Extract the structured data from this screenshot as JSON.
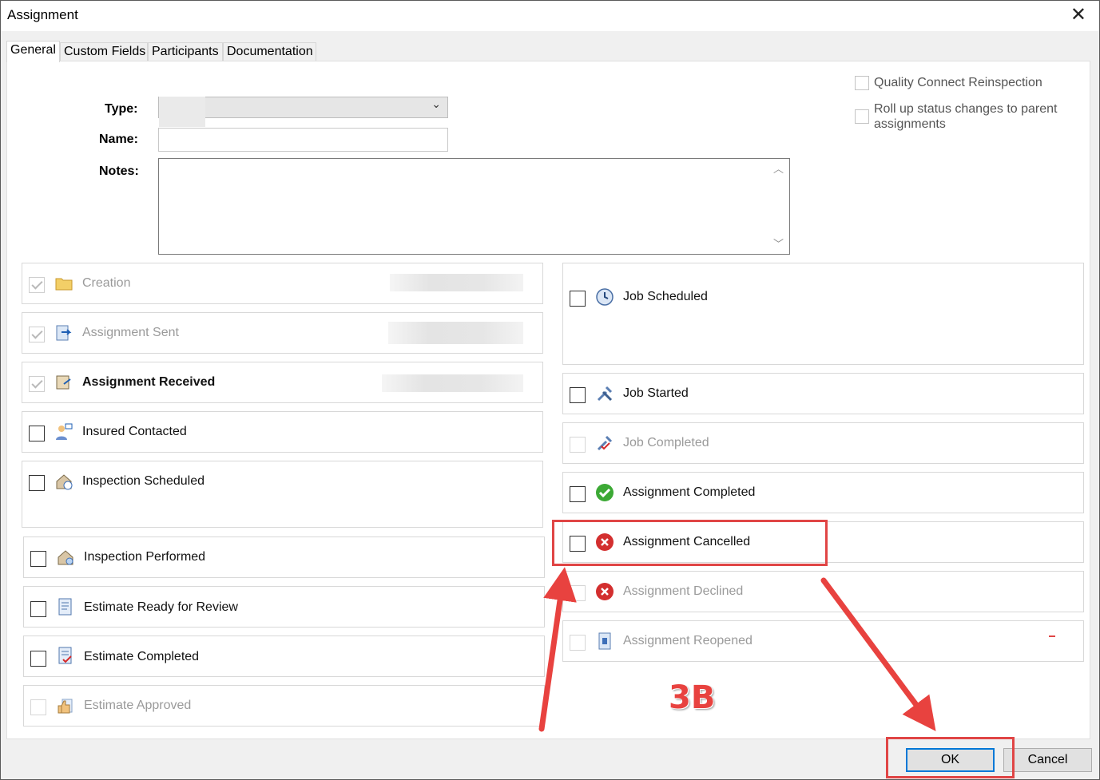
{
  "window": {
    "title": "Assignment",
    "close_glyph": "✕"
  },
  "tabs": [
    "General",
    "Custom Fields",
    "Participants",
    "Documentation"
  ],
  "form": {
    "type_label": "Type:",
    "name_label": "Name:",
    "notes_label": "Notes:",
    "chevron": "⌄",
    "sb_up": "︿",
    "sb_down": "﹀"
  },
  "options": {
    "quality": "Quality Connect Reinspection",
    "rollup": "Roll up status changes to parent assignments"
  },
  "left_items": [
    {
      "label": "Creation",
      "icon": "folder-icon",
      "state": "checked-disabled"
    },
    {
      "label": "Assignment Sent",
      "icon": "send-icon",
      "state": "checked-disabled"
    },
    {
      "label": "Assignment Received",
      "icon": "inbox-icon",
      "state": "checked-disabled"
    },
    {
      "label": "Insured Contacted",
      "icon": "person-phone-icon",
      "state": "unchecked"
    },
    {
      "label": "Inspection Scheduled",
      "icon": "house-clock-icon",
      "state": "unchecked"
    },
    {
      "label": "Inspection Performed",
      "icon": "house-icon",
      "state": "unchecked"
    },
    {
      "label": "Estimate Ready for Review",
      "icon": "document-icon",
      "state": "unchecked"
    },
    {
      "label": "Estimate Completed",
      "icon": "document-check-icon",
      "state": "unchecked"
    },
    {
      "label": "Estimate Approved",
      "icon": "thumbs-up-icon",
      "state": "disabled"
    }
  ],
  "right_items": [
    {
      "label": "Job Scheduled",
      "icon": "clock-icon",
      "state": "unchecked"
    },
    {
      "label": "Job Started",
      "icon": "tools-icon",
      "state": "unchecked"
    },
    {
      "label": "Job Completed",
      "icon": "tools-check-icon",
      "state": "disabled"
    },
    {
      "label": "Assignment Completed",
      "icon": "green-check-icon",
      "state": "unchecked"
    },
    {
      "label": "Assignment Cancelled",
      "icon": "red-x-icon",
      "state": "unchecked"
    },
    {
      "label": "Assignment Declined",
      "icon": "red-x-icon",
      "state": "disabled"
    },
    {
      "label": "Assignment Reopened",
      "icon": "reopen-icon",
      "state": "disabled"
    }
  ],
  "annotation": "3B",
  "buttons": {
    "ok": "OK",
    "cancel": "Cancel"
  },
  "colors": {
    "annotation_red": "#e04545",
    "ok_border": "#0078d7"
  }
}
